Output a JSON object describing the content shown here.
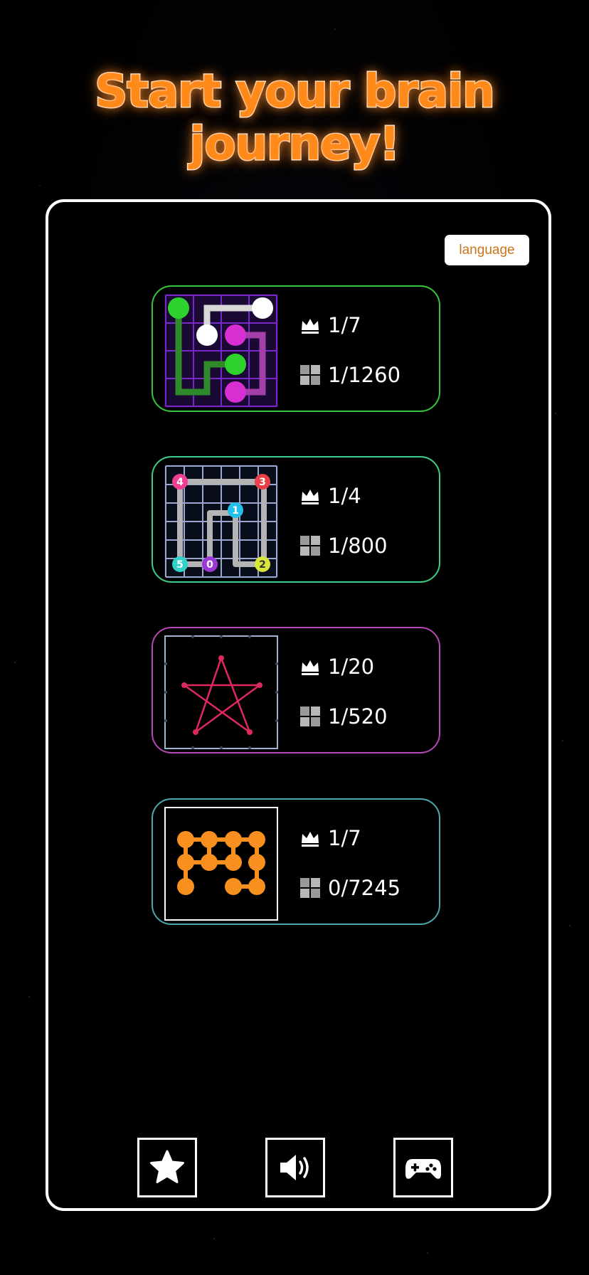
{
  "title": "Start your brain journey!",
  "language_button": "language",
  "levels": [
    {
      "name": "flow-lines",
      "border": "#35c63e",
      "crown": "1/7",
      "grid": "1/1260"
    },
    {
      "name": "numbered-path",
      "border": "#3ccf86",
      "crown": "1/4",
      "grid": "1/800"
    },
    {
      "name": "one-stroke-star",
      "border": "#b646b6",
      "crown": "1/20",
      "grid": "1/520"
    },
    {
      "name": "dot-connect",
      "border": "#4fa7ad",
      "crown": "1/7",
      "grid": "0/7245"
    }
  ],
  "bottom_bar": [
    "star-icon",
    "speaker-icon",
    "gamepad-icon"
  ],
  "colors": {
    "title": "#ff8a1a",
    "accent_orange": "#f7901e",
    "pink_line": "#e0285f"
  },
  "thumb_numbers": [
    "4",
    "3",
    "1",
    "5",
    "0",
    "2"
  ]
}
